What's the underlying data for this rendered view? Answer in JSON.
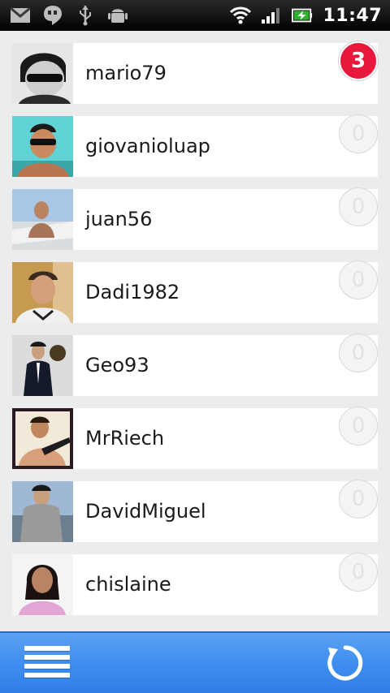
{
  "status_bar": {
    "time": "11:47",
    "left_icons": [
      "gmail-icon",
      "hangouts-icon",
      "usb-icon",
      "android-debug-icon"
    ],
    "right_icons": [
      "wifi-icon",
      "signal-icon",
      "battery-icon"
    ]
  },
  "contacts": [
    {
      "username": "mario79",
      "count": "3",
      "active": true
    },
    {
      "username": "giovanioluap",
      "count": "0",
      "active": false
    },
    {
      "username": "juan56",
      "count": "0",
      "active": false
    },
    {
      "username": "Dadi1982",
      "count": "0",
      "active": false
    },
    {
      "username": "Geo93",
      "count": "0",
      "active": false
    },
    {
      "username": "MrRiech",
      "count": "0",
      "active": false
    },
    {
      "username": "DavidMiguel",
      "count": "0",
      "active": false
    },
    {
      "username": "chislaine",
      "count": "0",
      "active": false
    }
  ],
  "bottom_bar": {
    "menu_icon": "menu-icon",
    "refresh_icon": "refresh-icon"
  },
  "colors": {
    "badge_active": "#e8173b",
    "bottom_bar": "#3f8ef0"
  }
}
